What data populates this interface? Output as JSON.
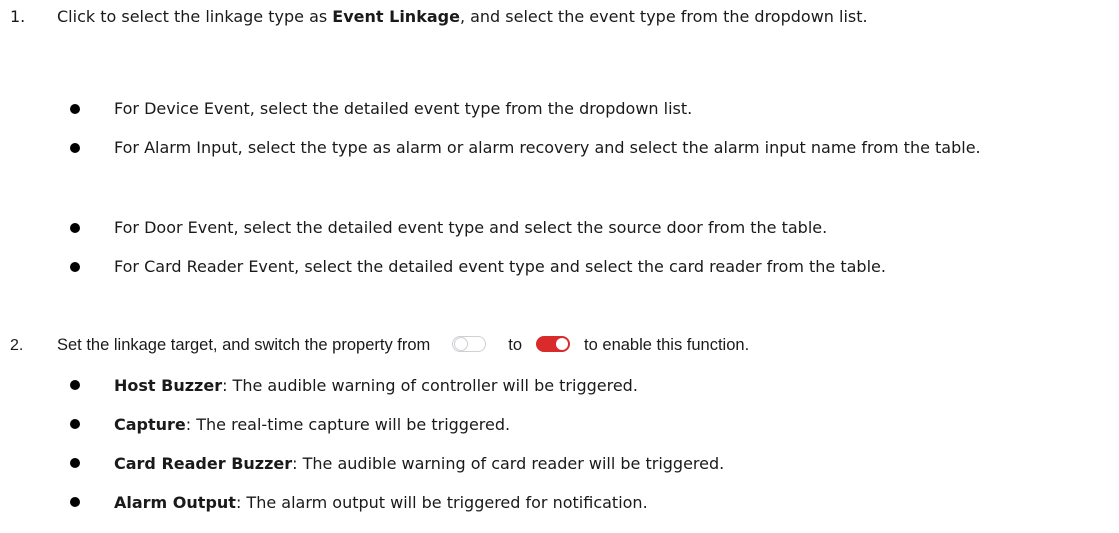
{
  "steps": [
    {
      "number": "1.",
      "text_before": "Click to select the linkage type as ",
      "bold": "Event Linkage",
      "text_after": ", and select the event type from the dropdown list.",
      "bullets": [
        "For Device Event, select the detailed event type from the dropdown list.",
        "For Alarm Input, select the type as alarm or alarm recovery and select the alarm input name from the table.",
        "For Door Event, select the detailed event type and select the source door from the table.",
        "For Card Reader Event, select the detailed event type and select the card reader from the table."
      ]
    },
    {
      "number": "2.",
      "text_before": "Set the linkage target, and switch the property from",
      "text_middle": "to",
      "text_after": "to enable this function.",
      "toggle_off_icon": "toggle-off-icon",
      "toggle_on_icon": "toggle-on-icon",
      "toggle_on_color": "#d92b2b",
      "bullets": [
        {
          "term": "Host Buzzer",
          "desc": ": The audible warning of controller will be triggered."
        },
        {
          "term": "Capture",
          "desc": ": The real-time capture will be triggered."
        },
        {
          "term": "Card Reader Buzzer",
          "desc": ": The audible warning of card reader will be triggered."
        },
        {
          "term": "Alarm Output",
          "desc": ": The alarm output will be triggered for notification."
        }
      ]
    }
  ]
}
